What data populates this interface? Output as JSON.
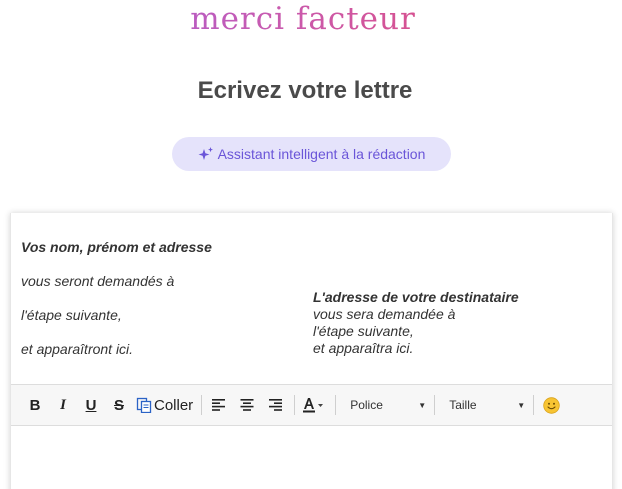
{
  "brand": {
    "logo": "merci facteur"
  },
  "page": {
    "title": "Ecrivez votre lettre"
  },
  "assistant": {
    "label": "Assistant intelligent à la rédaction",
    "icon": "sparkle-icon",
    "accent": "#6a55d8"
  },
  "letter": {
    "sender": {
      "title": "Vos nom, prénom et adresse",
      "lines": [
        "vous seront demandés à",
        "l'étape suivante,",
        "et apparaîtront ici."
      ]
    },
    "recipient": {
      "title": "L'adresse de votre destinataire",
      "lines": [
        "vous sera demandée à",
        "l'étape suivante,",
        "et apparaîtra ici."
      ]
    }
  },
  "toolbar": {
    "bold": "B",
    "italic": "I",
    "underline": "U",
    "strike": "S",
    "paste_label": "Coller",
    "font_select": "Police",
    "size_select": "Taille",
    "icons": [
      "bold-icon",
      "italic-icon",
      "underline-icon",
      "strikethrough-icon",
      "paste-icon",
      "align-left-icon",
      "align-center-icon",
      "align-right-icon",
      "text-color-icon",
      "emoji-icon"
    ]
  }
}
